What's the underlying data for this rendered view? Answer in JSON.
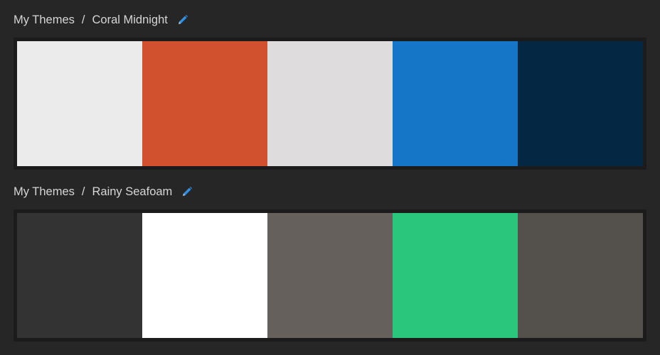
{
  "themes": [
    {
      "breadcrumb_root": "My Themes",
      "separator": "/",
      "name": "Coral Midnight",
      "colors": [
        "#ebebeb",
        "#d1512f",
        "#dedcdc",
        "#1576c8",
        "#042743"
      ]
    },
    {
      "breadcrumb_root": "My Themes",
      "separator": "/",
      "name": "Rainy Seafoam",
      "colors": [
        "#333333",
        "#ffffff",
        "#65605c",
        "#29c67b",
        "#54504b"
      ]
    }
  ],
  "icons": {
    "edit": "pencil-icon"
  },
  "accent_color": "#2f8fe0",
  "background_color": "#262626"
}
